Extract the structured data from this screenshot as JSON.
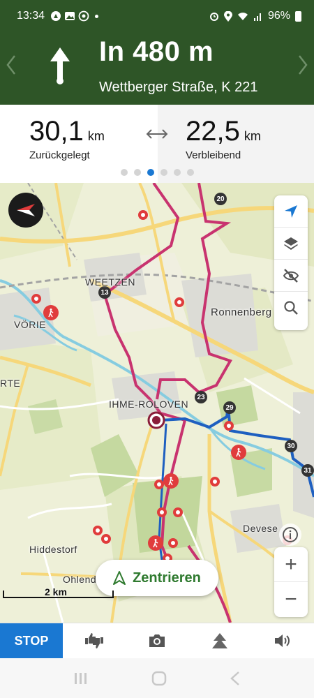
{
  "status_bar": {
    "time": "13:34",
    "battery": "96%",
    "icons": [
      "whatsapp-icon",
      "image-icon",
      "alarm-icon",
      "location-icon",
      "wifi-icon",
      "signal-icon",
      "battery-icon"
    ]
  },
  "navigation": {
    "distance": "In 480 m",
    "street": "Wettberger Straße, K 221",
    "maneuver_icon": "straight-arrow-icon"
  },
  "stats": {
    "travelled_value": "30,1",
    "travelled_unit": "km",
    "travelled_label": "Zurückgelegt",
    "remaining_value": "22,5",
    "remaining_unit": "km",
    "remaining_label": "Verbleibend",
    "pages": 6,
    "active_page": 3
  },
  "map": {
    "places": {
      "weetzen": "WEETZEN",
      "ronnenberg": "Ronnenberg",
      "vorie": "VÖRIE",
      "rte": "RTE",
      "ihme": "IHME-ROLOVEN",
      "devese": "Devese",
      "hiddestorf": "Hiddestorf",
      "ohlendorf": "Ohlend"
    },
    "route_markers": {
      "m13": "13",
      "m20": "20",
      "m23": "23",
      "m29": "29",
      "m30": "30",
      "m31": "31"
    },
    "scale_label": "2 km",
    "center_button_label": "Zentrieren",
    "colors": {
      "track": "#c8336f",
      "route": "#1e5fc0",
      "poi": "#e03c3c",
      "header": "#2e5527",
      "accent": "#1a78d2"
    }
  },
  "controls": {
    "map_buttons": [
      "navigate-icon",
      "layers-icon",
      "visibility-off-icon",
      "search-icon"
    ],
    "zoom_in": "+",
    "zoom_out": "−"
  },
  "toolbar": {
    "stop_label": "STOP",
    "tools": [
      "rate-icon",
      "camera-icon",
      "terrain-icon",
      "volume-icon"
    ]
  }
}
